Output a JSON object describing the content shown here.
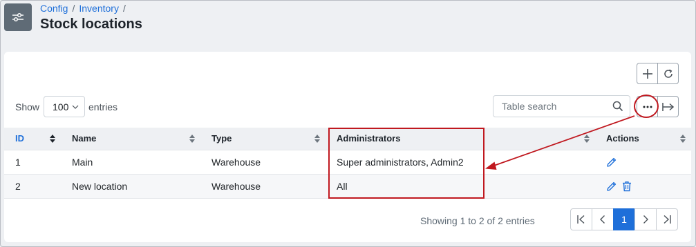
{
  "header": {
    "breadcrumb": [
      {
        "label": "Config"
      },
      {
        "label": "Inventory"
      }
    ],
    "separator": "/",
    "title": "Stock locations",
    "icon": "sliders-icon"
  },
  "toolbar": {
    "add_icon": "plus-icon",
    "refresh_icon": "refresh-icon",
    "more_icon": "ellipsis-icon",
    "export_icon": "arrow-to-right-icon"
  },
  "length_menu": {
    "show_label": "Show",
    "value": "100",
    "entries_label": "entries"
  },
  "search": {
    "placeholder": "Table search"
  },
  "table": {
    "columns": [
      "ID",
      "Name",
      "Type",
      "Administrators",
      "Actions"
    ],
    "rows": [
      {
        "id": "1",
        "name": "Main",
        "type": "Warehouse",
        "administrators": "Super administrators, Admin2",
        "actions": [
          "edit-icon"
        ]
      },
      {
        "id": "2",
        "name": "New location",
        "type": "Warehouse",
        "administrators": "All",
        "actions": [
          "edit-icon",
          "delete-icon"
        ]
      }
    ]
  },
  "footer": {
    "info": "Showing 1 to 2 of 2 entries",
    "current_page": "1"
  },
  "colors": {
    "accent": "#1e6fd9",
    "annotation": "#c0181f",
    "header_bg": "#eef0f3"
  }
}
